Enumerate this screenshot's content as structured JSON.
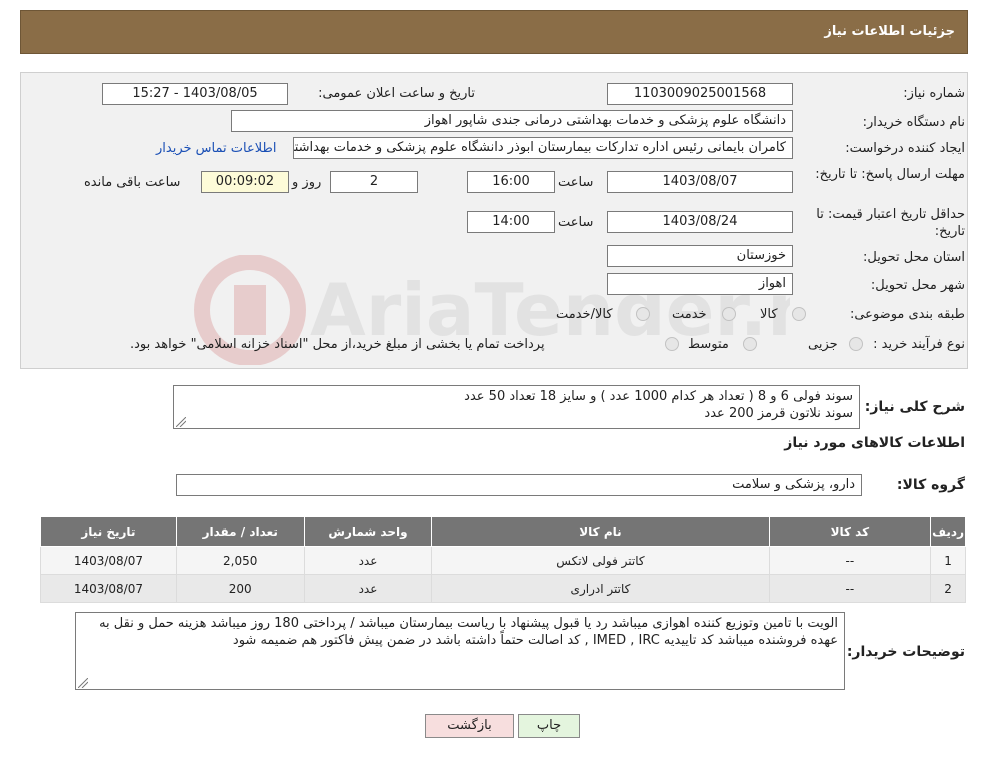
{
  "header": {
    "title": "جزئیات اطلاعات نیاز"
  },
  "form": {
    "need_number_label": "شماره نیاز:",
    "need_number": "1103009025001568",
    "announce_label": "تاریخ و ساعت اعلان عمومی:",
    "announce_value": "1403/08/05 - 15:27",
    "buyer_label": "نام دستگاه خریدار:",
    "buyer_value": "دانشگاه علوم پزشکی و خدمات بهداشتی درمانی جندی شاپور اهواز",
    "creator_label": "ایجاد کننده درخواست:",
    "creator_value": "کامران بایمانی رئیس اداره تدارکات بیمارستان ابوذر  دانشگاه علوم پزشکی و خدمات بهداشتی",
    "contact_link": "اطلاعات تماس خریدار",
    "deadline_label": "مهلت ارسال پاسخ: تا تاریخ:",
    "deadline_date": "1403/08/07",
    "time_label": "ساعت",
    "deadline_time": "16:00",
    "days_value": "2",
    "days_label": "روز و",
    "remaining_value": "00:09:02",
    "remaining_label": "ساعت باقی مانده",
    "validity_label": "حداقل تاریخ اعتبار قیمت: تا تاریخ:",
    "validity_date": "1403/08/24",
    "validity_time": "14:00",
    "province_label": "استان محل تحویل:",
    "province_value": "خوزستان",
    "city_label": "شهر محل تحویل:",
    "city_value": "اهواز",
    "category_label": "طبقه بندی موضوعی:",
    "category_options": [
      "کالا",
      "خدمت",
      "کالا/خدمت"
    ],
    "process_label": "نوع فرآیند خرید :",
    "process_options": [
      "جزیی",
      "متوسط"
    ],
    "process_note": "پرداخت تمام یا بخشی از مبلغ خرید،از محل \"اسناد خزانه اسلامی\" خواهد بود."
  },
  "description": {
    "label": "شرح کلی نیاز:",
    "line1": "سوند فولی 6 و 8 ( تعداد هر کدام 1000 عدد ) و سایز  18 تعداد 50 عدد",
    "line2": "سوند نلاتون قرمز     200  عدد"
  },
  "goods_info_label": "اطلاعات کالاهای مورد نیاز",
  "group": {
    "label": "گروه کالا:",
    "value": "دارو، پزشکی و سلامت"
  },
  "table": {
    "headers": [
      "ردیف",
      "کد کالا",
      "نام کالا",
      "واحد شمارش",
      "تعداد / مقدار",
      "تاریخ نیاز"
    ],
    "rows": [
      [
        "1",
        "--",
        "کاتتر فولی لاتکس",
        "عدد",
        "2,050",
        "1403/08/07"
      ],
      [
        "2",
        "--",
        "کاتتر ادراری",
        "عدد",
        "200",
        "1403/08/07"
      ]
    ]
  },
  "notes": {
    "label": "توضیحات خریدار:",
    "text": "الویت با تامین وتوزیع کننده اهوازی  میباشد رد یا قبول پیشنهاد با ریاست بیمارستان میباشد / پرداختی 180 روز   میباشد هزینه حمل و نقل به عهده فروشنده میباشد   کد تاییدیه IMED , IRC , کد اصالت حتماً داشته باشد در ضمن پیش فاکتور هم ضمیمه شود"
  },
  "buttons": {
    "print": "چاپ",
    "back": "بازگشت"
  },
  "colors": {
    "header": "#8a6d47",
    "table_header": "#757575",
    "link": "#1a4fb5",
    "back_button": "#f7dede",
    "print_button": "#e4f5de"
  }
}
